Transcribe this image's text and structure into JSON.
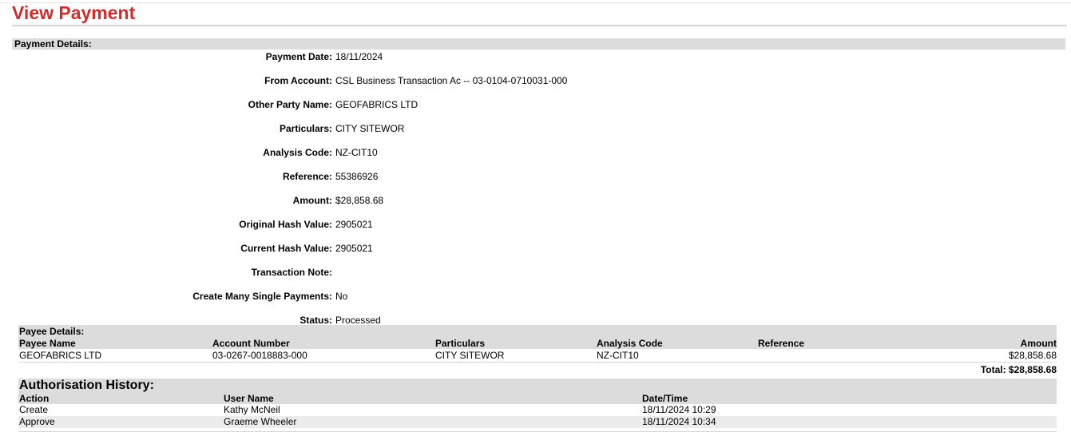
{
  "page": {
    "title": "View Payment"
  },
  "payment_details": {
    "heading": "Payment Details:",
    "fields": [
      {
        "label": "Payment Date:",
        "value": "18/11/2024"
      },
      {
        "label": "From Account:",
        "value": "CSL Business Transaction Ac -- 03-0104-0710031-000"
      },
      {
        "label": "Other Party Name:",
        "value": "GEOFABRICS LTD"
      },
      {
        "label": "Particulars:",
        "value": "CITY SITEWOR"
      },
      {
        "label": "Analysis Code:",
        "value": "NZ-CIT10"
      },
      {
        "label": "Reference:",
        "value": "55386926"
      },
      {
        "label": "Amount:",
        "value": "$28,858.68"
      },
      {
        "label": "Original Hash Value:",
        "value": "2905021"
      },
      {
        "label": "Current Hash Value:",
        "value": "2905021"
      },
      {
        "label": "Transaction Note:",
        "value": ""
      },
      {
        "label": "Create Many Single Payments:",
        "value": "No"
      },
      {
        "label": "Status:",
        "value": "Processed"
      }
    ]
  },
  "payee_details": {
    "heading": "Payee Details:",
    "columns": {
      "payee_name": "Payee Name",
      "account_number": "Account Number",
      "particulars": "Particulars",
      "analysis_code": "Analysis Code",
      "reference": "Reference",
      "amount": "Amount"
    },
    "rows": [
      {
        "payee_name": "GEOFABRICS LTD",
        "account_number": "03-0267-0018883-000",
        "particulars": "CITY SITEWOR",
        "analysis_code": "NZ-CIT10",
        "reference": "",
        "amount": "$28,858.68"
      }
    ],
    "total": "Total: $28,858.68"
  },
  "authorisation_history": {
    "heading": "Authorisation History:",
    "columns": {
      "action": "Action",
      "user_name": "User Name",
      "date_time": "Date/Time"
    },
    "rows": [
      {
        "action": "Create",
        "user_name": "Kathy McNeil",
        "date_time": "18/11/2024 10:29"
      },
      {
        "action": "Approve",
        "user_name": "Graeme Wheeler",
        "date_time": "18/11/2024 10:34"
      }
    ]
  },
  "colors": {
    "title": "#d22b2b",
    "section_bg": "#dcdcdc",
    "alt_row": "#ececec"
  }
}
